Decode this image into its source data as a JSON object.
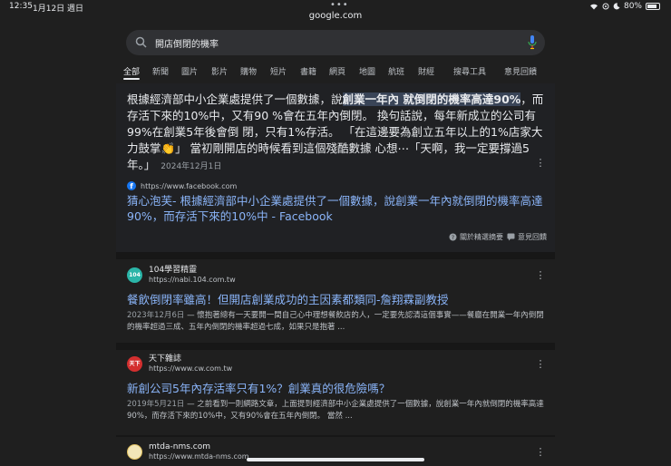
{
  "status": {
    "time": "12:35",
    "date": "1月12日 週日",
    "battery": "80%",
    "battery_level": 0.8
  },
  "browser": {
    "url": "google.com"
  },
  "search": {
    "query": "開店倒閉的機率"
  },
  "tabs": [
    "全部",
    "新聞",
    "圖片",
    "影片",
    "購物",
    "短片",
    "書籍",
    "網頁",
    "地圖",
    "航班",
    "財經",
    "搜尋工具",
    "意見回饋"
  ],
  "featured": {
    "snippet_before": "根據經濟部中小企業處提供了一個數據，說",
    "snippet_highlight": "創業一年內 就倒閉的機率高達90%",
    "snippet_after": "，而存活下來的10%中，又有90 %會在五年內倒閉。 換句話說，每年新成立的公司有99%在創業5年後會倒 閉，只有1%存活。 「在這邊要為創立五年以上的1%店家大力鼓掌👏」 當初剛開店的時候看到這個殘酷數據 心想⋯「天啊，我一定要撐過5年。」",
    "date": "2024年12月1日",
    "source_url": "https://www.facebook.com",
    "title": "猜心泡芙- 根據經濟部中小企業處提供了一個數據，說創業一年內就倒閉的機率高達90%，而存活下來的10%中 - Facebook",
    "about": "關於精選摘要",
    "feedback": "意見回饋"
  },
  "results": [
    {
      "site": "104學習精靈",
      "url": "https://nabi.104.com.tw",
      "favicon_text": "104",
      "title": "餐飲倒閉率雖高！但開店創業成功的主因素都類同-詹翔霖副教授",
      "date": "2023年12月6日",
      "desc": "— 懷抱著總有一天要開一間自己心中理想餐飲店的人，一定要先認清這個事實——餐廳在開業一年內倒閉的機率超過三成、五年內倒閉的機率超過七成，如果只是抱著 ..."
    },
    {
      "site": "天下雜誌",
      "url": "https://www.cw.com.tw",
      "favicon_text": "天下",
      "title": "新創公司5年內存活率只有1%？創業真的很危險嗎？",
      "date": "2019年5月21日",
      "desc": "— 之前看到一則網路文章，上面提到經濟部中小企業處提供了一個數據，說創業一年內就倒閉的機率高達90%，而存活下來的10%中，又有90%會在五年內倒閉。 當然 ..."
    },
    {
      "site": "mtda-nms.com",
      "url": "https://www.mtda-nms.com",
      "favicon_text": ""
    }
  ],
  "colors": {
    "background": "#1f1f1f",
    "link": "#8ab4f8",
    "highlight": "#394457",
    "facebook": "#1877f2",
    "fav104": "#2bb5a8",
    "favcw": "#d32f2f",
    "favmtda": "#e0c060"
  }
}
